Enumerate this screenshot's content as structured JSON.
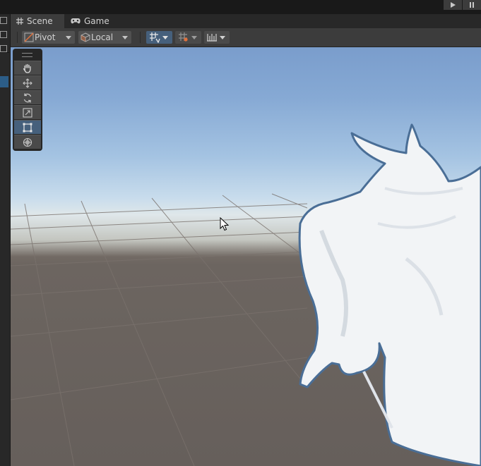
{
  "window": {
    "play_icon": "play-icon",
    "pause_icon": "pause-icon"
  },
  "tabs": [
    {
      "label": "Scene",
      "icon": "scene-grid-icon",
      "active": true
    },
    {
      "label": "Game",
      "icon": "game-controller-icon",
      "active": false
    }
  ],
  "toolbar": {
    "pivot_label": "Pivot",
    "pivot_icon": "pivot-icon",
    "space_label": "Local",
    "space_icon": "local-cube-icon",
    "grid_snap_icon": "grid-snap-icon",
    "grid_increment_icon": "grid-increment-icon",
    "ruler_icon": "increment-snap-icon"
  },
  "tool_palette": {
    "tools": [
      {
        "name": "view-tool",
        "icon": "hand-icon",
        "selected": false
      },
      {
        "name": "move-tool",
        "icon": "move-arrows-icon",
        "selected": false
      },
      {
        "name": "rotate-tool",
        "icon": "rotate-icon",
        "selected": false
      },
      {
        "name": "scale-tool",
        "icon": "scale-icon",
        "selected": false
      },
      {
        "name": "rect-tool",
        "icon": "rect-transform-icon",
        "selected": true
      },
      {
        "name": "transform-tool",
        "icon": "transform-icon",
        "selected": false
      }
    ]
  },
  "colors": {
    "selected_accent": "#46607c",
    "selection_outline": "#4a6e96",
    "model_fill": "#f2f4f6",
    "ground": "#665f5b"
  }
}
